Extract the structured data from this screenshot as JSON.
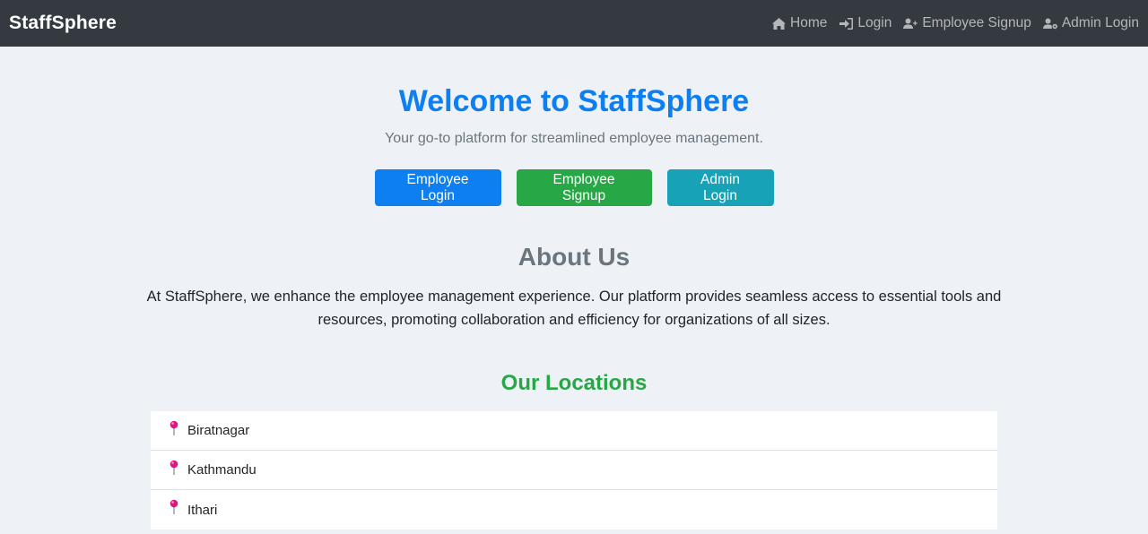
{
  "navbar": {
    "brand": "StaffSphere",
    "links": [
      {
        "label": "Home",
        "icon": "home-icon"
      },
      {
        "label": "Login",
        "icon": "sign-in-icon"
      },
      {
        "label": "Employee Signup",
        "icon": "user-plus-icon"
      },
      {
        "label": "Admin Login",
        "icon": "user-gear-icon"
      }
    ]
  },
  "hero": {
    "title": "Welcome to StaffSphere",
    "subtitle": "Your go-to platform for streamlined employee management.",
    "buttons": [
      {
        "label": "Employee Login",
        "color": "#0d7ff0"
      },
      {
        "label": "Employee Signup",
        "color": "#27a745"
      },
      {
        "label": "Admin Login",
        "color": "#17a2b8"
      }
    ]
  },
  "about": {
    "title": "About Us",
    "text": "At StaffSphere, we enhance the employee management experience. Our platform provides seamless access to essential tools and resources, promoting collaboration and efficiency for organizations of all sizes."
  },
  "locations": {
    "title": "Our Locations",
    "icon": "pushpin-icon",
    "items": [
      "Biratnagar",
      "Kathmandu",
      "Ithari"
    ]
  },
  "colors": {
    "navbar_bg": "#343a40",
    "page_bg": "#eef2f7",
    "primary": "#0d7ff0",
    "success": "#27a745",
    "info": "#17a2b8",
    "pin": "#e0157f"
  }
}
